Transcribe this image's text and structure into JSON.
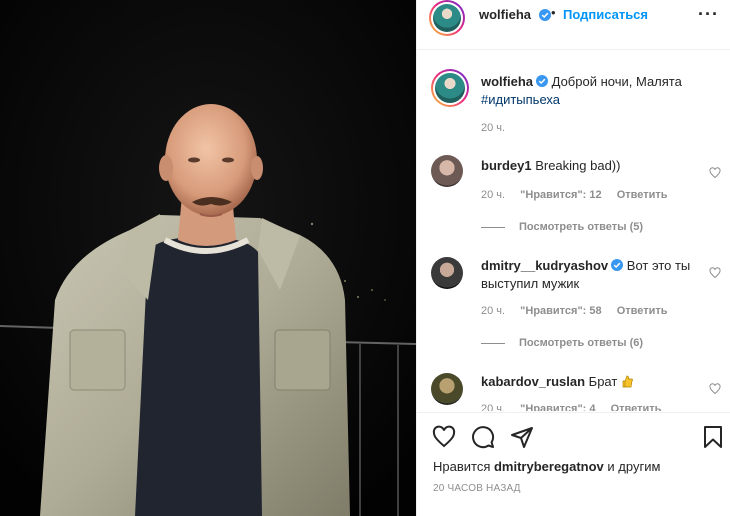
{
  "post": {
    "author": "wolfieha",
    "follow_label": "Подписаться",
    "dot": "•",
    "more": "···"
  },
  "caption": {
    "author": "wolfieha",
    "text": " Доброй ночи, Малята",
    "hashtag": "#идитыпьеха",
    "time": "20 ч."
  },
  "comments": [
    {
      "user": "burdey1",
      "text": " Breaking bad))",
      "time": "20 ч.",
      "likes": "\"Нравится\": 12",
      "reply": "Ответить",
      "view_replies": "Посмотреть ответы (5)"
    },
    {
      "user": "dmitry__kudryashov",
      "text": " Вот это ты выступил мужик",
      "time": "20 ч.",
      "likes": "\"Нравится\": 58",
      "reply": "Ответить",
      "view_replies": "Посмотреть ответы (6)"
    },
    {
      "user": "kabardov_ruslan",
      "text": " Брат",
      "time": "20 ч.",
      "likes": "\"Нравится\": 4",
      "reply": "Ответить"
    }
  ],
  "footer": {
    "likes_prefix": "Нравится ",
    "likes_user": "dmitryberegatnov",
    "likes_suffix": " и другим",
    "timestamp": "20 ЧАСОВ НАЗАД"
  },
  "colors": {
    "link": "#0095f6",
    "hashtag": "#00376b",
    "muted": "#8e8e8e",
    "text": "#262626",
    "verified": "#3897f0"
  },
  "icons": [
    "heart-icon",
    "comment-icon",
    "share-icon",
    "bookmark-icon",
    "verified-icon",
    "more-icon",
    "thumbs-up-emoji"
  ]
}
